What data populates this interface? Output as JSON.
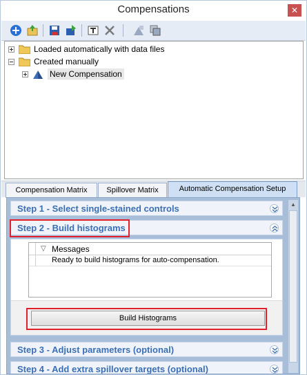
{
  "window": {
    "title": "Compensations"
  },
  "toolbar": {
    "buttons": [
      "add-icon",
      "import-icon",
      "save-icon",
      "export-icon",
      "rename-icon",
      "delete-icon",
      "apply-icon",
      "copy-icon"
    ]
  },
  "tree": {
    "nodes": [
      {
        "label": "Loaded automatically with data files"
      },
      {
        "label": "Created manually"
      },
      {
        "label": "New Compensation"
      }
    ]
  },
  "tabs": [
    {
      "label": "Compensation Matrix"
    },
    {
      "label": "Spillover Matrix"
    },
    {
      "label": "Automatic Compensation Setup"
    }
  ],
  "steps": [
    {
      "title": "Step 1 - Select single-stained controls"
    },
    {
      "title": "Step 2 - Build histograms"
    },
    {
      "title": "Step 3 - Adjust parameters (optional)"
    },
    {
      "title": "Step 4 - Add extra spillover targets (optional)"
    }
  ],
  "messages": {
    "column": "Messages",
    "rows": [
      "Ready to build histograms for auto-compensation."
    ]
  },
  "build_button": {
    "label": "Build Histograms"
  },
  "colors": {
    "accent": "#3a6fb5",
    "highlight": "#e0202a",
    "panel": "#a7bdd8"
  }
}
